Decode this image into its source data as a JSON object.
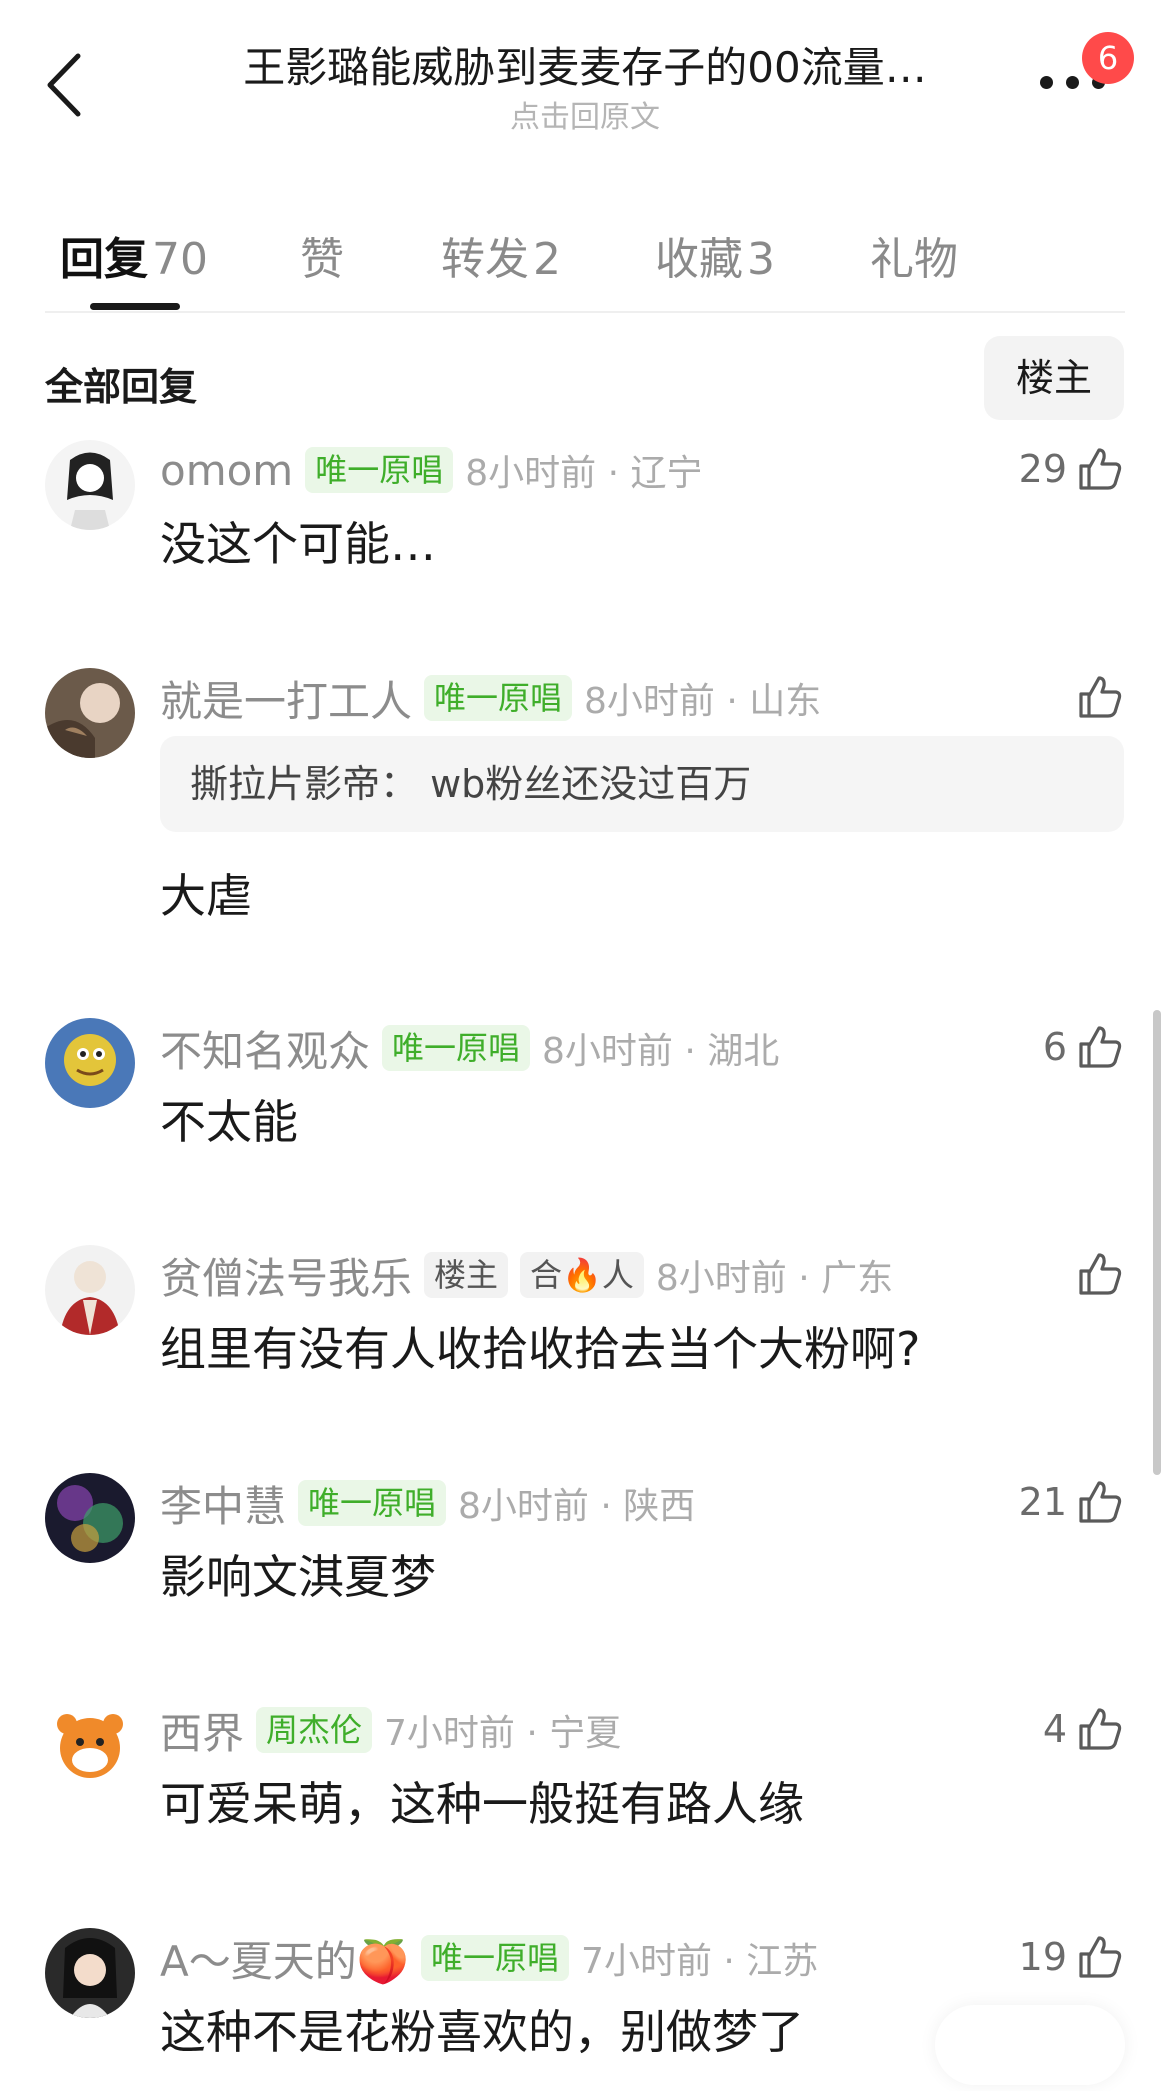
{
  "header": {
    "title": "王影璐能威胁到麦麦存子的00流量…",
    "subtitle": "点击回原文",
    "badge_count": "6"
  },
  "tabs": [
    {
      "label": "回复",
      "count": "70",
      "active": true
    },
    {
      "label": "赞",
      "count": ""
    },
    {
      "label": "转发",
      "count": "2"
    },
    {
      "label": "收藏",
      "count": "3"
    },
    {
      "label": "礼物",
      "count": ""
    }
  ],
  "section": {
    "title": "全部回复",
    "filter_label": "楼主"
  },
  "comments": [
    {
      "username": "omom",
      "tags": [
        "唯一原唱"
      ],
      "time": "8小时前 · 辽宁",
      "likes": "29",
      "text": "没这个可能…"
    },
    {
      "username": "就是一打工人",
      "tags": [
        "唯一原唱"
      ],
      "time": "8小时前 · 山东",
      "likes": "",
      "quote": "撕拉片影帝：  wb粉丝还没过百万",
      "text": "大虐"
    },
    {
      "username": "不知名观众",
      "tags": [
        "唯一原唱"
      ],
      "time": "8小时前 · 湖北",
      "likes": "6",
      "text": "不太能"
    },
    {
      "username": "贫僧法号我乐",
      "tags": [
        "楼主",
        "合🔥人"
      ],
      "time": "8小时前 · 广东",
      "likes": "",
      "text": "组里有没有人收拾收拾去当个大粉啊?"
    },
    {
      "username": "李中慧",
      "tags": [
        "唯一原唱"
      ],
      "time": "8小时前 · 陕西",
      "likes": "21",
      "text": "影响文淇夏梦"
    },
    {
      "username": "西界",
      "tags": [
        "周杰伦"
      ],
      "time": "7小时前 · 宁夏",
      "likes": "4",
      "text": "可爱呆萌，这种一般挺有路人缘"
    },
    {
      "username": "A～夏天的🍑",
      "tags": [
        "唯一原唱"
      ],
      "time": "7小时前 · 江苏",
      "likes": "19",
      "text": "这种不是花粉喜欢的，别做梦了"
    }
  ],
  "icons": {
    "back": "chevron-left-icon",
    "more": "more-dots-icon",
    "like": "thumbs-up-icon"
  },
  "colors": {
    "tag_green_text": "#3fae2a",
    "tag_green_bg": "#eaf7e7",
    "badge_red": "#ff4a4a",
    "muted_text": "#8c8c8c"
  }
}
